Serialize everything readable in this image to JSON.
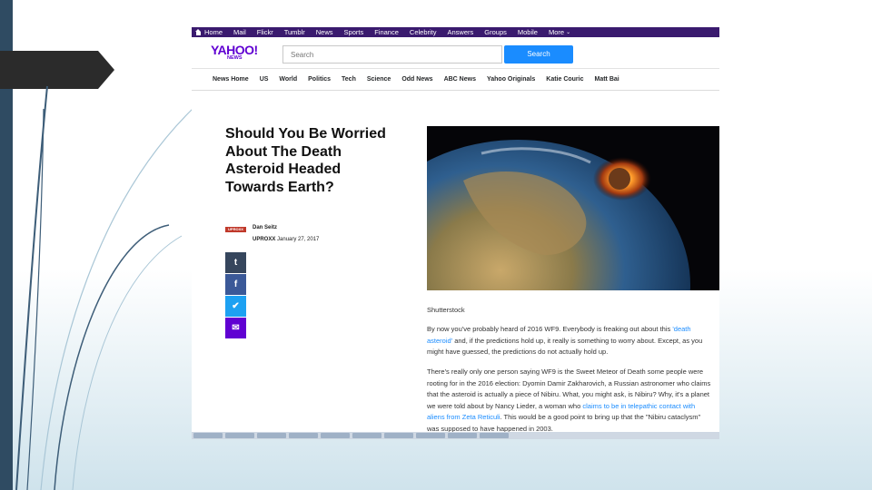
{
  "topnav": {
    "items": [
      "Home",
      "Mail",
      "Flickr",
      "Tumblr",
      "News",
      "Sports",
      "Finance",
      "Celebrity",
      "Answers",
      "Groups",
      "Mobile",
      "More"
    ]
  },
  "header": {
    "logo": "YAHOO!",
    "logo_sub": "NEWS",
    "search_placeholder": "Search",
    "search_button": "Search"
  },
  "subnav": {
    "items": [
      "News Home",
      "US",
      "World",
      "Politics",
      "Tech",
      "Science",
      "Odd News",
      "ABC News",
      "Yahoo Originals",
      "Katie Couric",
      "Matt Bai"
    ]
  },
  "article": {
    "title": "Should You Be Worried About The Death Asteroid Headed Towards Earth?",
    "publisher_logo": "UPROXX",
    "author": "Dan Seitz",
    "publisher": "UPROXX",
    "date": "January 27, 2017",
    "share": [
      "t",
      "f",
      "✔",
      "✉"
    ],
    "image_caption": "Shutterstock",
    "p1_a": "By now you've probably heard of 2016 WF9. Everybody is freaking out about this ",
    "p1_link": "'death asteroid'",
    "p1_b": " and, if the predictions hold up, it really is something to worry about. Except, as you might have guessed, the predictions do not actually hold up.",
    "p2_a": "There's really only one person saying WF9 is the Sweet Meteor of Death some people were rooting for in the 2016 election: Dyomin Damir Zakharovich, a Russian astronomer who claims that the asteroid is actually a piece of Nibiru. What, you might ask, is Nibiru? Why, it's a planet we were told about by Nancy Lieder, a woman who ",
    "p2_link": "claims to be in telepathic contact with aliens from Zeta Reticuli",
    "p2_b": ". This would be a good point to bring up that the \"Nibiru cataclysm\" was supposed to have happened in 2003."
  },
  "colors": {
    "topnav_bg": "#3a1a6e",
    "brand": "#6001d2",
    "search_button": "#1a8cff",
    "link": "#1a8cff",
    "slide_bar": "#2f4b62"
  }
}
